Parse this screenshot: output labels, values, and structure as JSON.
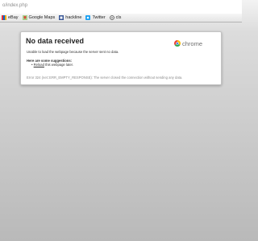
{
  "browser": {
    "url": "o/index.php",
    "bookmarks": [
      {
        "label": "eBay",
        "icon": "ebay-icon"
      },
      {
        "label": "Google Maps",
        "icon": "google-maps-icon"
      },
      {
        "label": "hackline",
        "icon": "hackline-icon"
      },
      {
        "label": "Twitter",
        "icon": "twitter-icon"
      },
      {
        "label": "cls",
        "icon": "cls-icon"
      }
    ]
  },
  "error_page": {
    "title": "No data received",
    "brand": "chrome",
    "description": "Unable to load the webpage because the server sent no data.",
    "suggestions_heading": "Here are some suggestions:",
    "suggestion_link": "Reload",
    "suggestion_rest": " this webpage later.",
    "error_code": "Error 324 (net::ERR_EMPTY_RESPONSE): The server closed the connection without sending any data."
  }
}
